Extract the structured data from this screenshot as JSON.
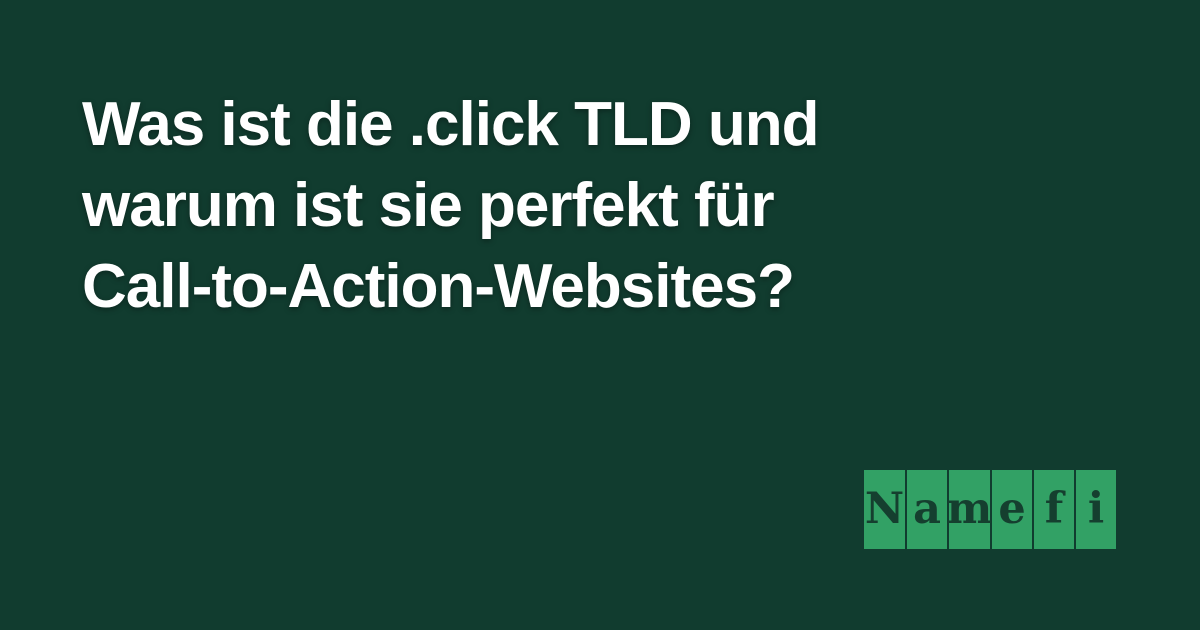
{
  "headline": {
    "lines": [
      "Was ist die .click TLD und",
      "warum ist sie perfekt für",
      "Call-to-Action-Websites?"
    ]
  },
  "logo": {
    "letters": [
      "N",
      "a",
      "m",
      "e",
      "f",
      "i"
    ],
    "brand": "Namefi"
  },
  "colors": {
    "background": "#113c2f",
    "headline": "#ffffff",
    "logo_tile": "#32a165",
    "logo_text": "#153f2f"
  }
}
